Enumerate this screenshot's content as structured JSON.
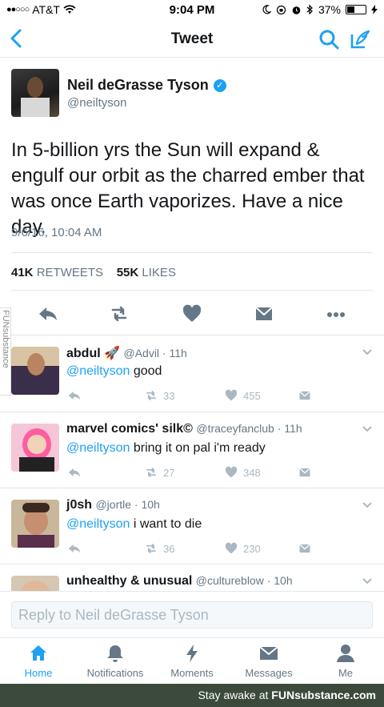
{
  "status_bar": {
    "carrier": "AT&T",
    "signal": "●●○○○",
    "time": "9:04 PM",
    "battery": "37%",
    "battery_level": 0.37
  },
  "nav": {
    "title": "Tweet"
  },
  "tweet": {
    "name": "Neil deGrasse Tyson",
    "handle": "@neiltyson",
    "text": "In 5-billion yrs the Sun will expand & engulf our orbit as the charred ember that was once Earth vaporizes. Have a nice day.",
    "date": "9/6/16, 10:04 AM",
    "retweets_count": "41K",
    "retweets_label": "RETWEETS",
    "likes_count": "55K",
    "likes_label": "LIKES"
  },
  "replies": [
    {
      "name": "abdul 🚀",
      "meta": "@Advil · 11h",
      "mention": "@neiltyson",
      "text": " good",
      "retweets": "33",
      "likes": "455"
    },
    {
      "name": "marvel comics' silk©",
      "meta": "@traceyfanclub · 11h",
      "mention": "@neiltyson",
      "text": " bring it on pal i'm ready",
      "retweets": "27",
      "likes": "348"
    },
    {
      "name": "j0sh",
      "meta": "@jortle · 10h",
      "mention": "@neiltyson",
      "text": " i want to die",
      "retweets": "36",
      "likes": "230"
    },
    {
      "name": "unhealthy & unusual",
      "meta": "@cultureblow · 10h"
    }
  ],
  "reply_bar": {
    "placeholder": "Reply to Neil deGrasse Tyson"
  },
  "tabs": [
    {
      "label": "Home",
      "icon": "home-icon"
    },
    {
      "label": "Notifications",
      "icon": "bell-icon"
    },
    {
      "label": "Moments",
      "icon": "lightning-icon"
    },
    {
      "label": "Messages",
      "icon": "envelope-icon"
    },
    {
      "label": "Me",
      "icon": "person-icon"
    }
  ],
  "footer": {
    "prefix": "Stay awake at ",
    "brand": "FUNsubstance.com"
  },
  "watermark": "FUNsubstance",
  "colors": {
    "accent": "#1da1f2",
    "muted": "#657786",
    "light": "#aab8c2",
    "footer_bg": "#3c4a3c"
  }
}
